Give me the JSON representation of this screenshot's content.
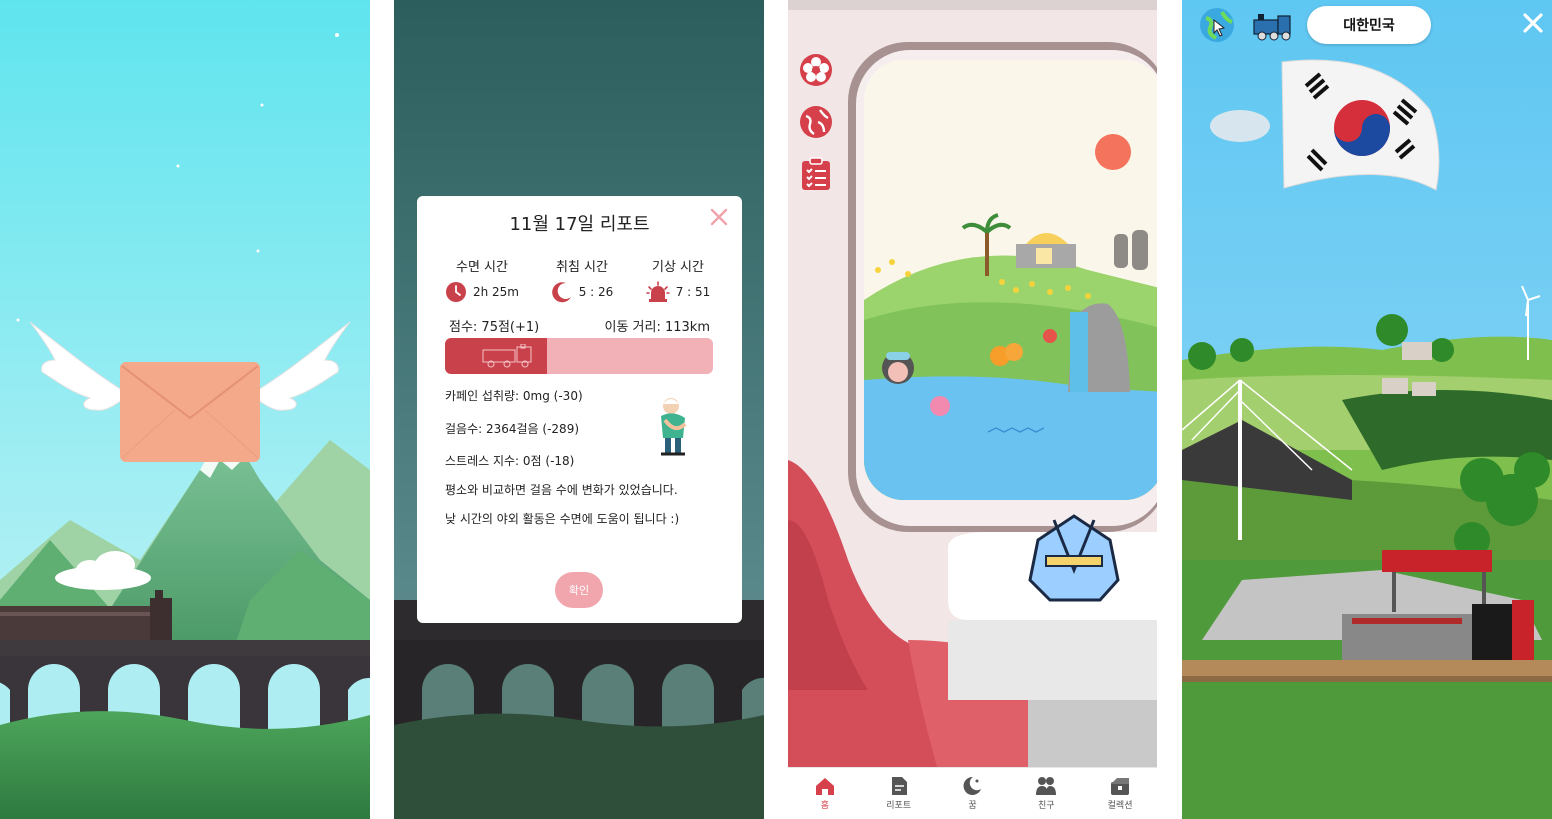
{
  "report": {
    "title": "11월 17일 리포트",
    "sleep_label": "수면 시간",
    "sleep_value": "2h 25m",
    "bed_label": "취침 시간",
    "bed_value": "5 : 26",
    "wake_label": "기상 시간",
    "wake_value": "7 : 51",
    "score": "점수: 75점(+1)",
    "distance": "이동 거리: 113km",
    "score_fraction": 0.38,
    "caffeine": "카페인 섭취량: 0mg (-30)",
    "steps": "걸음수: 2364걸음 (-289)",
    "stress": "스트레스 지수: 0점 (-18)",
    "comment1": "평소와 비교하면 걸음 수에 변화가 있었습니다.",
    "comment2": "낮 시간의 야외 활동은 수면에 도움이 됩니다 :)",
    "confirm": "확인"
  },
  "nav": {
    "tabs": [
      {
        "label": "홈",
        "icon": "home-icon"
      },
      {
        "label": "리포트",
        "icon": "report-icon"
      },
      {
        "label": "꿈",
        "icon": "dream-icon"
      },
      {
        "label": "친구",
        "icon": "friends-icon"
      },
      {
        "label": "컬렉션",
        "icon": "collection-icon"
      }
    ]
  },
  "map": {
    "country": "대한민국"
  },
  "colors": {
    "accent": "#d5404a",
    "bar_bg": "#f2b1b6",
    "bar_fill": "#c9414b",
    "button": "#f1a5ad"
  }
}
